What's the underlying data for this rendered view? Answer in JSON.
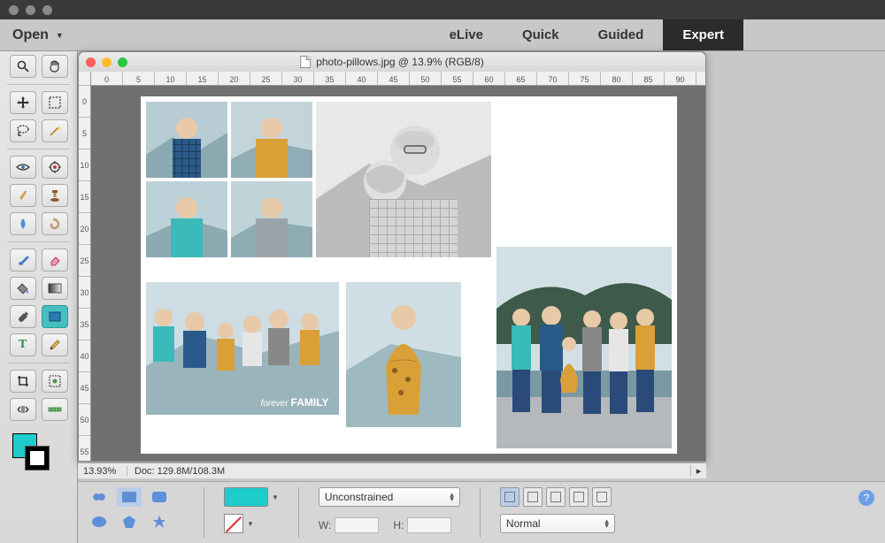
{
  "menubar": {
    "open_label": "Open",
    "modes": [
      "eLive",
      "Quick",
      "Guided",
      "Expert"
    ],
    "active_mode": "Expert"
  },
  "document": {
    "title": "photo-pillows.jpg @ 13.9% (RGB/8)",
    "zoom": "13.93%",
    "info": "Doc: 129.8M/108.3M"
  },
  "ruler": {
    "top_ticks": [
      "0",
      "5",
      "10",
      "15",
      "20",
      "25",
      "30",
      "35",
      "40",
      "45",
      "50",
      "55",
      "60",
      "65",
      "70",
      "75",
      "80",
      "85",
      "90"
    ],
    "left_ticks": [
      "0",
      "5",
      "10",
      "15",
      "20",
      "25",
      "30",
      "35",
      "40",
      "45",
      "50",
      "55"
    ]
  },
  "options": {
    "aspect_label": "Unconstrained",
    "w_label": "W:",
    "h_label": "H:",
    "blend_label": "Normal"
  },
  "collage_text": "forever FAMILY",
  "colors": {
    "accent": "#1ecccb",
    "active_tab_bg": "#2b2b2b"
  }
}
